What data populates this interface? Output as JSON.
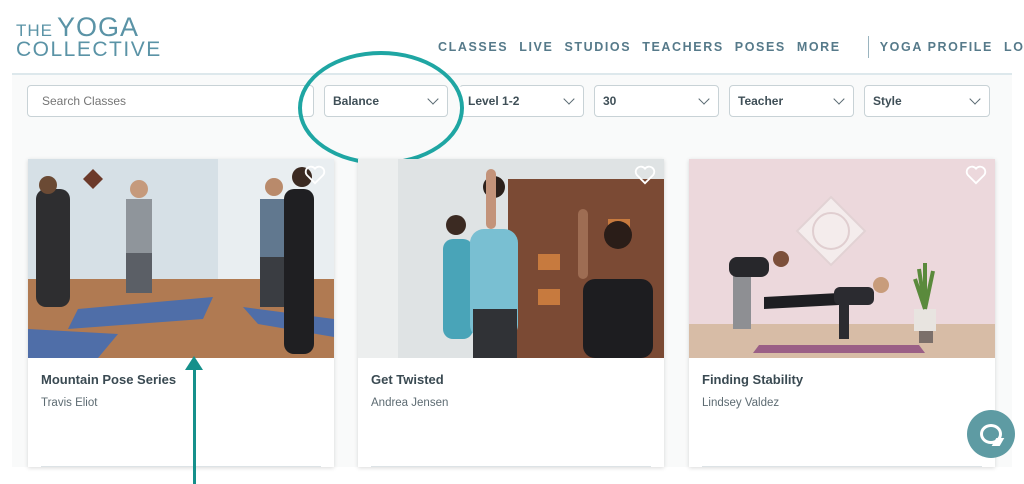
{
  "brand": {
    "the": "THE",
    "yoga": "YOGA",
    "collective": "COLLECTIVE"
  },
  "nav": {
    "items": [
      "CLASSES",
      "LIVE",
      "STUDIOS",
      "TEACHERS",
      "POSES",
      "MORE"
    ],
    "profile": "YOGA PROFILE",
    "logout": "LOGOUT"
  },
  "filters": {
    "search_placeholder": "Search Classes",
    "focus": "Balance",
    "level": "Level 1-2",
    "duration": "30",
    "teacher": "Teacher",
    "style": "Style"
  },
  "cards": [
    {
      "title": "Mountain Pose Series",
      "teacher": "Travis Eliot"
    },
    {
      "title": "Get Twisted",
      "teacher": "Andrea Jensen"
    },
    {
      "title": "Finding Stability",
      "teacher": "Lindsey Valdez"
    }
  ],
  "icons": {
    "heart": "heart-icon",
    "chevron": "chevron-down-icon",
    "chat": "chat-icon"
  },
  "colors": {
    "brand": "#5a93a6",
    "annotation": "#1fa6a3",
    "chat": "#5e9ba3"
  }
}
